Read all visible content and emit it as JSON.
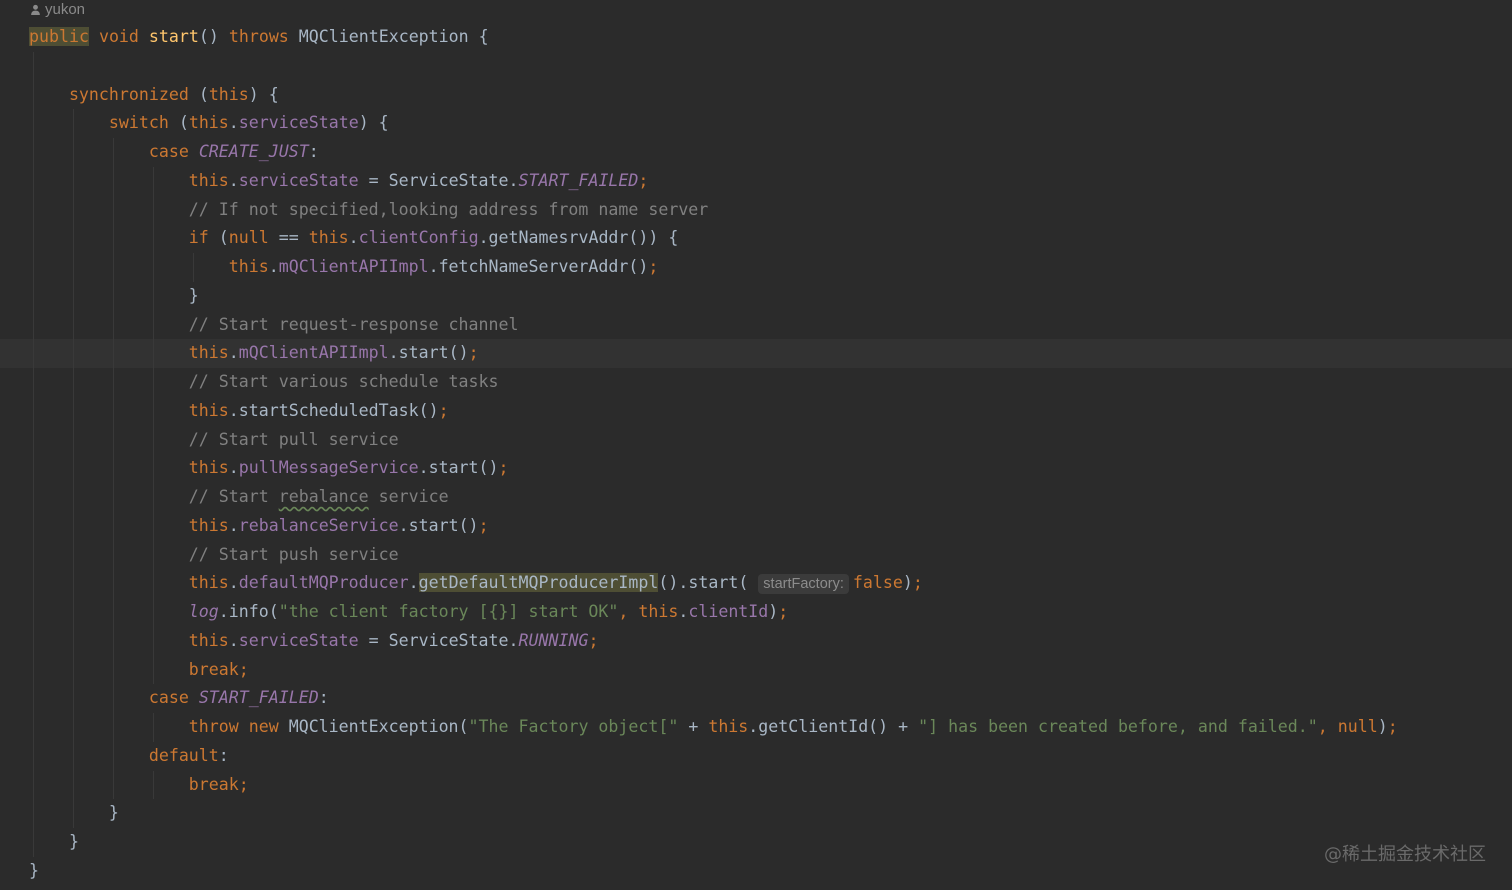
{
  "author": "yukon",
  "watermark": "@稀土掘金技术社区",
  "current_line": 11,
  "lines": [
    {
      "indent": 0,
      "tokens": [
        [
          "k hl",
          "public"
        ],
        [
          "t",
          " "
        ],
        [
          "k",
          "void"
        ],
        [
          "t",
          " "
        ],
        [
          "m",
          "start"
        ],
        [
          "t",
          "() "
        ],
        [
          "k",
          "throws"
        ],
        [
          "t",
          " MQClientException {"
        ]
      ]
    },
    {
      "indent": 0,
      "tokens": []
    },
    {
      "indent": 1,
      "tokens": [
        [
          "k",
          "synchronized"
        ],
        [
          "t",
          " ("
        ],
        [
          "k",
          "this"
        ],
        [
          "t",
          ") {"
        ]
      ]
    },
    {
      "indent": 2,
      "tokens": [
        [
          "k",
          "switch"
        ],
        [
          "t",
          " ("
        ],
        [
          "k",
          "this"
        ],
        [
          "t",
          "."
        ],
        [
          "f",
          "serviceState"
        ],
        [
          "t",
          ") {"
        ]
      ]
    },
    {
      "indent": 3,
      "tokens": [
        [
          "k",
          "case"
        ],
        [
          "t",
          " "
        ],
        [
          "i",
          "CREATE_JUST"
        ],
        [
          "t",
          ":"
        ]
      ]
    },
    {
      "indent": 4,
      "tokens": [
        [
          "k",
          "this"
        ],
        [
          "t",
          "."
        ],
        [
          "f",
          "serviceState"
        ],
        [
          "t",
          " = ServiceState."
        ],
        [
          "i",
          "START_FAILED"
        ],
        [
          "k",
          ";"
        ]
      ]
    },
    {
      "indent": 4,
      "tokens": [
        [
          "c",
          "// If not specified,looking address from name server"
        ]
      ]
    },
    {
      "indent": 4,
      "tokens": [
        [
          "k",
          "if"
        ],
        [
          "t",
          " ("
        ],
        [
          "k",
          "null"
        ],
        [
          "t",
          " == "
        ],
        [
          "k",
          "this"
        ],
        [
          "t",
          "."
        ],
        [
          "f",
          "clientConfig"
        ],
        [
          "t",
          ".getNamesrvAddr()) {"
        ]
      ]
    },
    {
      "indent": 5,
      "tokens": [
        [
          "k",
          "this"
        ],
        [
          "t",
          "."
        ],
        [
          "f",
          "mQClientAPIImpl"
        ],
        [
          "t",
          ".fetchNameServerAddr()"
        ],
        [
          "k",
          ";"
        ]
      ]
    },
    {
      "indent": 4,
      "tokens": [
        [
          "t",
          "}"
        ]
      ]
    },
    {
      "indent": 4,
      "tokens": [
        [
          "c",
          "// Start request-response channel"
        ]
      ]
    },
    {
      "indent": 4,
      "tokens": [
        [
          "k",
          "this"
        ],
        [
          "t",
          "."
        ],
        [
          "f",
          "mQClientAPIImpl"
        ],
        [
          "t",
          "."
        ],
        [
          "t",
          "start"
        ],
        [
          "t",
          "()"
        ],
        [
          "k",
          ";"
        ]
      ]
    },
    {
      "indent": 4,
      "tokens": [
        [
          "c",
          "// Start various schedule tasks"
        ]
      ]
    },
    {
      "indent": 4,
      "tokens": [
        [
          "k",
          "this"
        ],
        [
          "t",
          ".startScheduledTask()"
        ],
        [
          "k",
          ";"
        ]
      ]
    },
    {
      "indent": 4,
      "tokens": [
        [
          "c",
          "// Start pull service"
        ]
      ]
    },
    {
      "indent": 4,
      "tokens": [
        [
          "k",
          "this"
        ],
        [
          "t",
          "."
        ],
        [
          "f",
          "pullMessageService"
        ],
        [
          "t",
          ".start()"
        ],
        [
          "k",
          ";"
        ]
      ]
    },
    {
      "indent": 4,
      "tokens": [
        [
          "c",
          "// Start "
        ],
        [
          "c u",
          "rebalance"
        ],
        [
          "c",
          " service"
        ]
      ]
    },
    {
      "indent": 4,
      "tokens": [
        [
          "k",
          "this"
        ],
        [
          "t",
          "."
        ],
        [
          "f",
          "rebalanceService"
        ],
        [
          "t",
          ".start()"
        ],
        [
          "k",
          ";"
        ]
      ]
    },
    {
      "indent": 4,
      "tokens": [
        [
          "c",
          "// Start push service"
        ]
      ]
    },
    {
      "indent": 4,
      "tokens": [
        [
          "k",
          "this"
        ],
        [
          "t",
          "."
        ],
        [
          "f",
          "defaultMQProducer"
        ],
        [
          "t",
          "."
        ],
        [
          "t hl",
          "getDefaultMQProducerImpl"
        ],
        [
          "t",
          "().start( "
        ],
        [
          "h",
          "startFactory:"
        ],
        [
          "k",
          "false"
        ],
        [
          "t",
          ")"
        ],
        [
          "k",
          ";"
        ]
      ]
    },
    {
      "indent": 4,
      "tokens": [
        [
          "i",
          "log"
        ],
        [
          "t",
          ".info("
        ],
        [
          "s",
          "\"the client factory [{}] start OK\""
        ],
        [
          "k",
          ", this"
        ],
        [
          "t",
          "."
        ],
        [
          "f",
          "clientId"
        ],
        [
          "t",
          ")"
        ],
        [
          "k",
          ";"
        ]
      ]
    },
    {
      "indent": 4,
      "tokens": [
        [
          "k",
          "this"
        ],
        [
          "t",
          "."
        ],
        [
          "f",
          "serviceState"
        ],
        [
          "t",
          " = ServiceState."
        ],
        [
          "i",
          "RUNNING"
        ],
        [
          "k",
          ";"
        ]
      ]
    },
    {
      "indent": 4,
      "tokens": [
        [
          "k",
          "break;"
        ]
      ]
    },
    {
      "indent": 3,
      "tokens": [
        [
          "k",
          "case"
        ],
        [
          "t",
          " "
        ],
        [
          "i",
          "START_FAILED"
        ],
        [
          "t",
          ":"
        ]
      ]
    },
    {
      "indent": 4,
      "tokens": [
        [
          "k",
          "throw new"
        ],
        [
          "t",
          " MQClientException("
        ],
        [
          "s",
          "\"The Factory object[\""
        ],
        [
          "t",
          " + "
        ],
        [
          "k",
          "this"
        ],
        [
          "t",
          ".getClientId() + "
        ],
        [
          "s",
          "\"] has been created before, and failed.\""
        ],
        [
          "k",
          ", null"
        ],
        [
          "t",
          ")"
        ],
        [
          "k",
          ";"
        ]
      ]
    },
    {
      "indent": 3,
      "tokens": [
        [
          "k",
          "default"
        ],
        [
          "t",
          ":"
        ]
      ]
    },
    {
      "indent": 4,
      "tokens": [
        [
          "k",
          "break;"
        ]
      ]
    },
    {
      "indent": 2,
      "tokens": [
        [
          "t",
          "}"
        ]
      ]
    },
    {
      "indent": 1,
      "tokens": [
        [
          "t",
          "}"
        ]
      ]
    },
    {
      "indent": 0,
      "tokens": [
        [
          "t",
          "}"
        ]
      ]
    }
  ]
}
